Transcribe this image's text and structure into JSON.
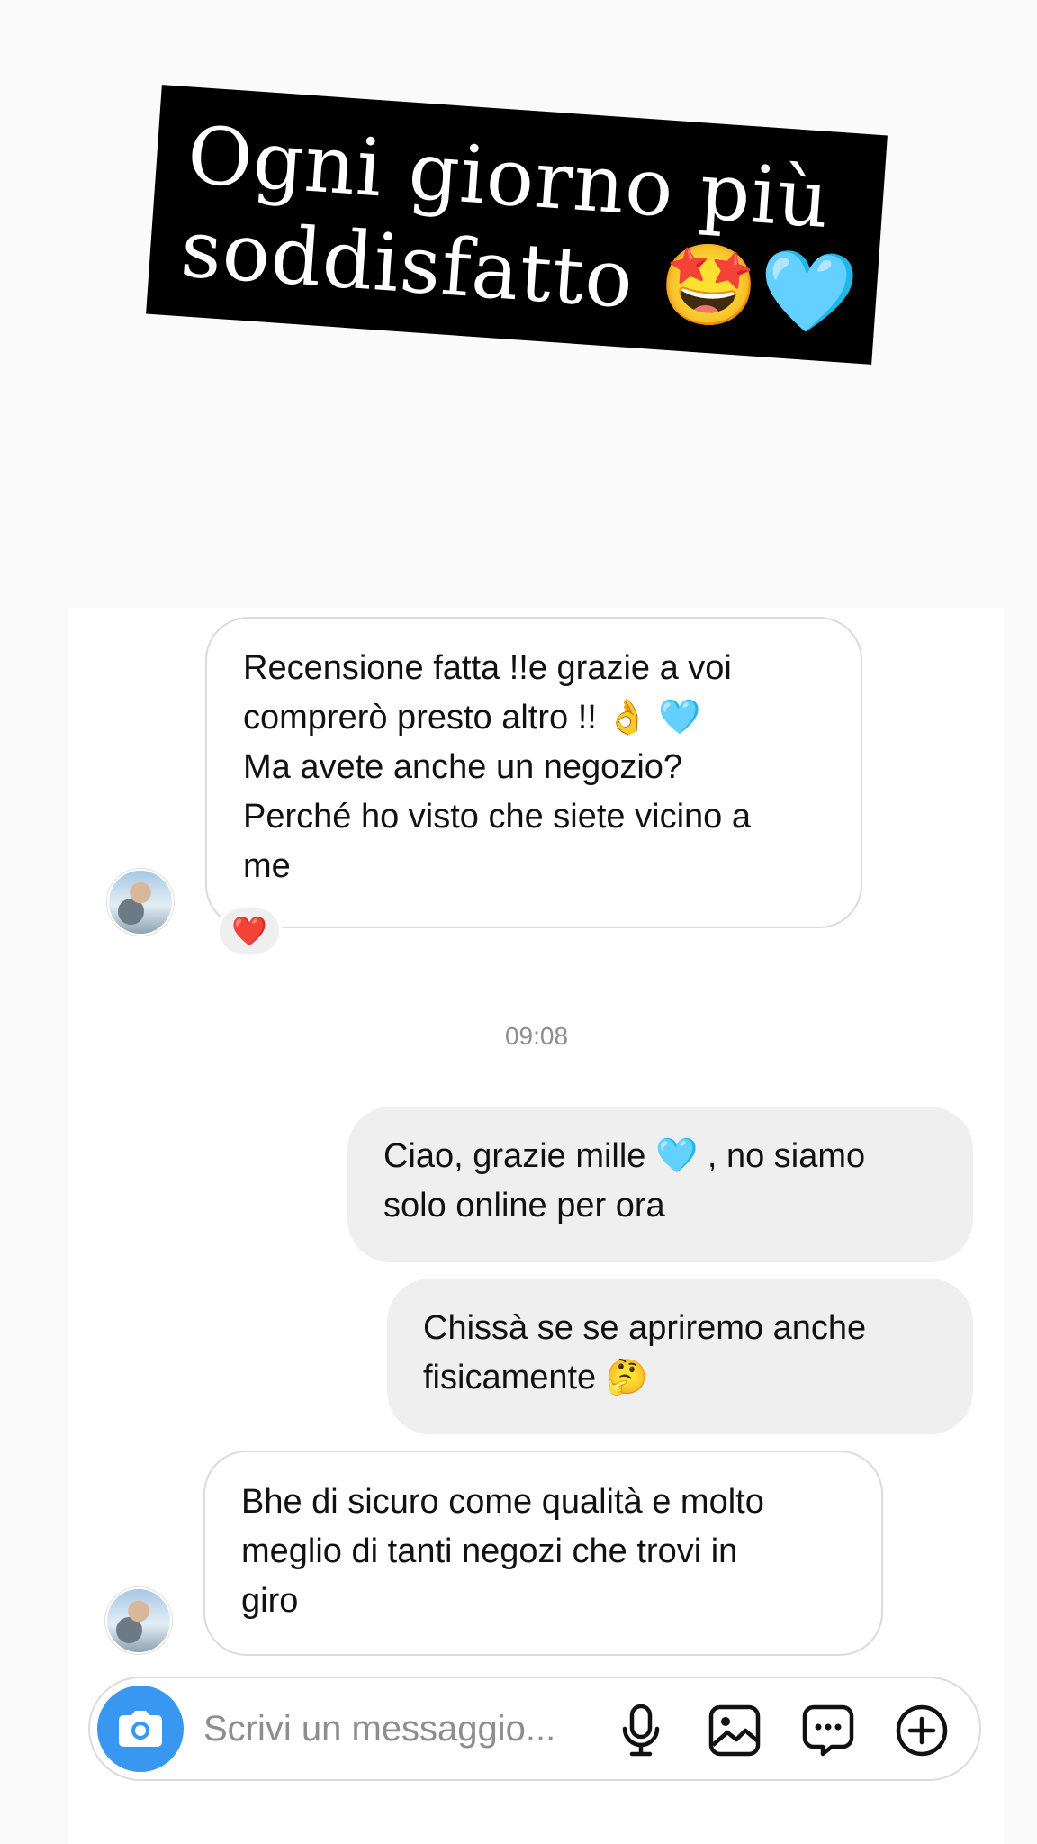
{
  "caption": {
    "line1": "Ogni giorno più",
    "line2": "soddisfatto 🤩🩵"
  },
  "messages": [
    {
      "side": "incoming",
      "lines": [
        "Recensione fatta !!e grazie a voi",
        "comprerò presto altro !! 👌 🩵",
        "Ma avete anche un negozio?",
        "Perché ho visto che siete vicino a",
        "me"
      ],
      "reaction": "❤️"
    },
    {
      "side": "outgoing",
      "lines": [
        "Ciao, grazie mille 🩵 , no siamo",
        "solo online per ora"
      ]
    },
    {
      "side": "outgoing",
      "lines": [
        "Chissà se se apriremo anche",
        "fisicamente 🤔"
      ]
    },
    {
      "side": "incoming",
      "lines": [
        "Bhe di sicuro come qualità e molto",
        "meglio di tanti negozi che trovi in",
        "giro"
      ]
    }
  ],
  "timestamp": "09:08",
  "composer": {
    "placeholder": "Scrivi un messaggio...",
    "icons": [
      "camera-icon",
      "microphone-icon",
      "image-icon",
      "sticker-chat-icon",
      "plus-circle-icon"
    ]
  },
  "colors": {
    "accent": "#3897f0",
    "outgoing_bubble": "#efefef",
    "incoming_border": "#dbdbdb",
    "caption_bg": "#000000"
  }
}
